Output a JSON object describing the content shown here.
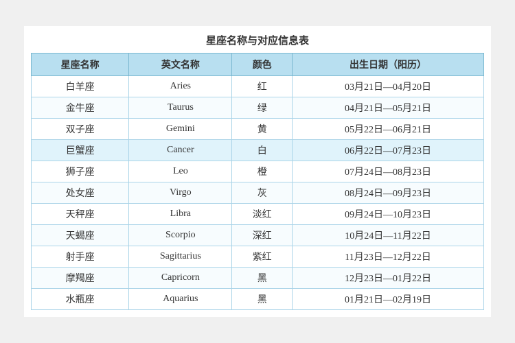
{
  "title": "星座名称与对应信息表",
  "table": {
    "headers": [
      "星座名称",
      "英文名称",
      "颜色",
      "出生日期（阳历）"
    ],
    "rows": [
      {
        "chinese": "白羊座",
        "english": "Aries",
        "color": "红",
        "dates": "03月21日—04月20日"
      },
      {
        "chinese": "金牛座",
        "english": "Taurus",
        "color": "绿",
        "dates": "04月21日—05月21日"
      },
      {
        "chinese": "双子座",
        "english": "Gemini",
        "color": "黄",
        "dates": "05月22日—06月21日"
      },
      {
        "chinese": "巨蟹座",
        "english": "Cancer",
        "color": "白",
        "dates": "06月22日—07月23日"
      },
      {
        "chinese": "狮子座",
        "english": "Leo",
        "color": "橙",
        "dates": "07月24日—08月23日"
      },
      {
        "chinese": "处女座",
        "english": "Virgo",
        "color": "灰",
        "dates": "08月24日—09月23日"
      },
      {
        "chinese": "天秤座",
        "english": "Libra",
        "color": "淡红",
        "dates": "09月24日—10月23日"
      },
      {
        "chinese": "天蝎座",
        "english": "Scorpio",
        "color": "深红",
        "dates": "10月24日—11月22日"
      },
      {
        "chinese": "射手座",
        "english": "Sagittarius",
        "color": "紫红",
        "dates": "11月23日—12月22日"
      },
      {
        "chinese": "摩羯座",
        "english": "Capricorn",
        "color": "黑",
        "dates": "12月23日—01月22日"
      },
      {
        "chinese": "水瓶座",
        "english": "Aquarius",
        "color": "黑",
        "dates": "01月21日—02月19日"
      }
    ]
  }
}
